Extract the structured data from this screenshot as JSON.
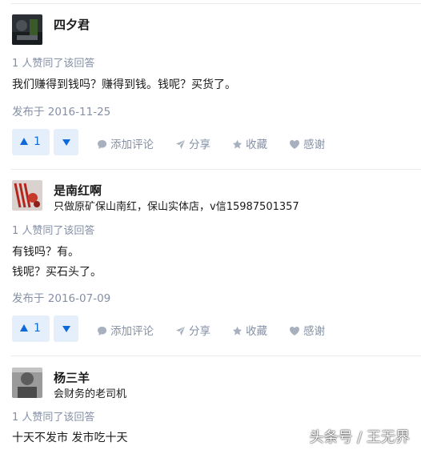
{
  "answers": [
    {
      "author": {
        "name": "四夕君",
        "bio": ""
      },
      "votes_text": "1 人赞同了该回答",
      "content": [
        "我们赚得到钱吗？赚得到钱。钱呢？买货了。"
      ],
      "date": "发布于 2016-11-25",
      "upvotes": "1"
    },
    {
      "author": {
        "name": "是南红啊",
        "bio": "只做原矿保山南红，保山实体店，v信15987501357"
      },
      "votes_text": "1 人赞同了该回答",
      "content": [
        "有钱吗？有。",
        "钱呢？买石头了。"
      ],
      "date": "发布于 2016-07-09",
      "upvotes": "1"
    },
    {
      "author": {
        "name": "杨三羊",
        "bio": "会财务的老司机"
      },
      "votes_text": "1 人赞同了该回答",
      "content": [
        "十天不发市 发市吃十天"
      ]
    }
  ],
  "actions": {
    "comment": "添加评论",
    "share": "分享",
    "favorite": "收藏",
    "thanks": "感谢"
  },
  "watermark": "头条号 / 王无界",
  "colors": {
    "accent": "#0f6ad9",
    "vote_bg": "#e5eefb",
    "muted": "#8590a6"
  }
}
